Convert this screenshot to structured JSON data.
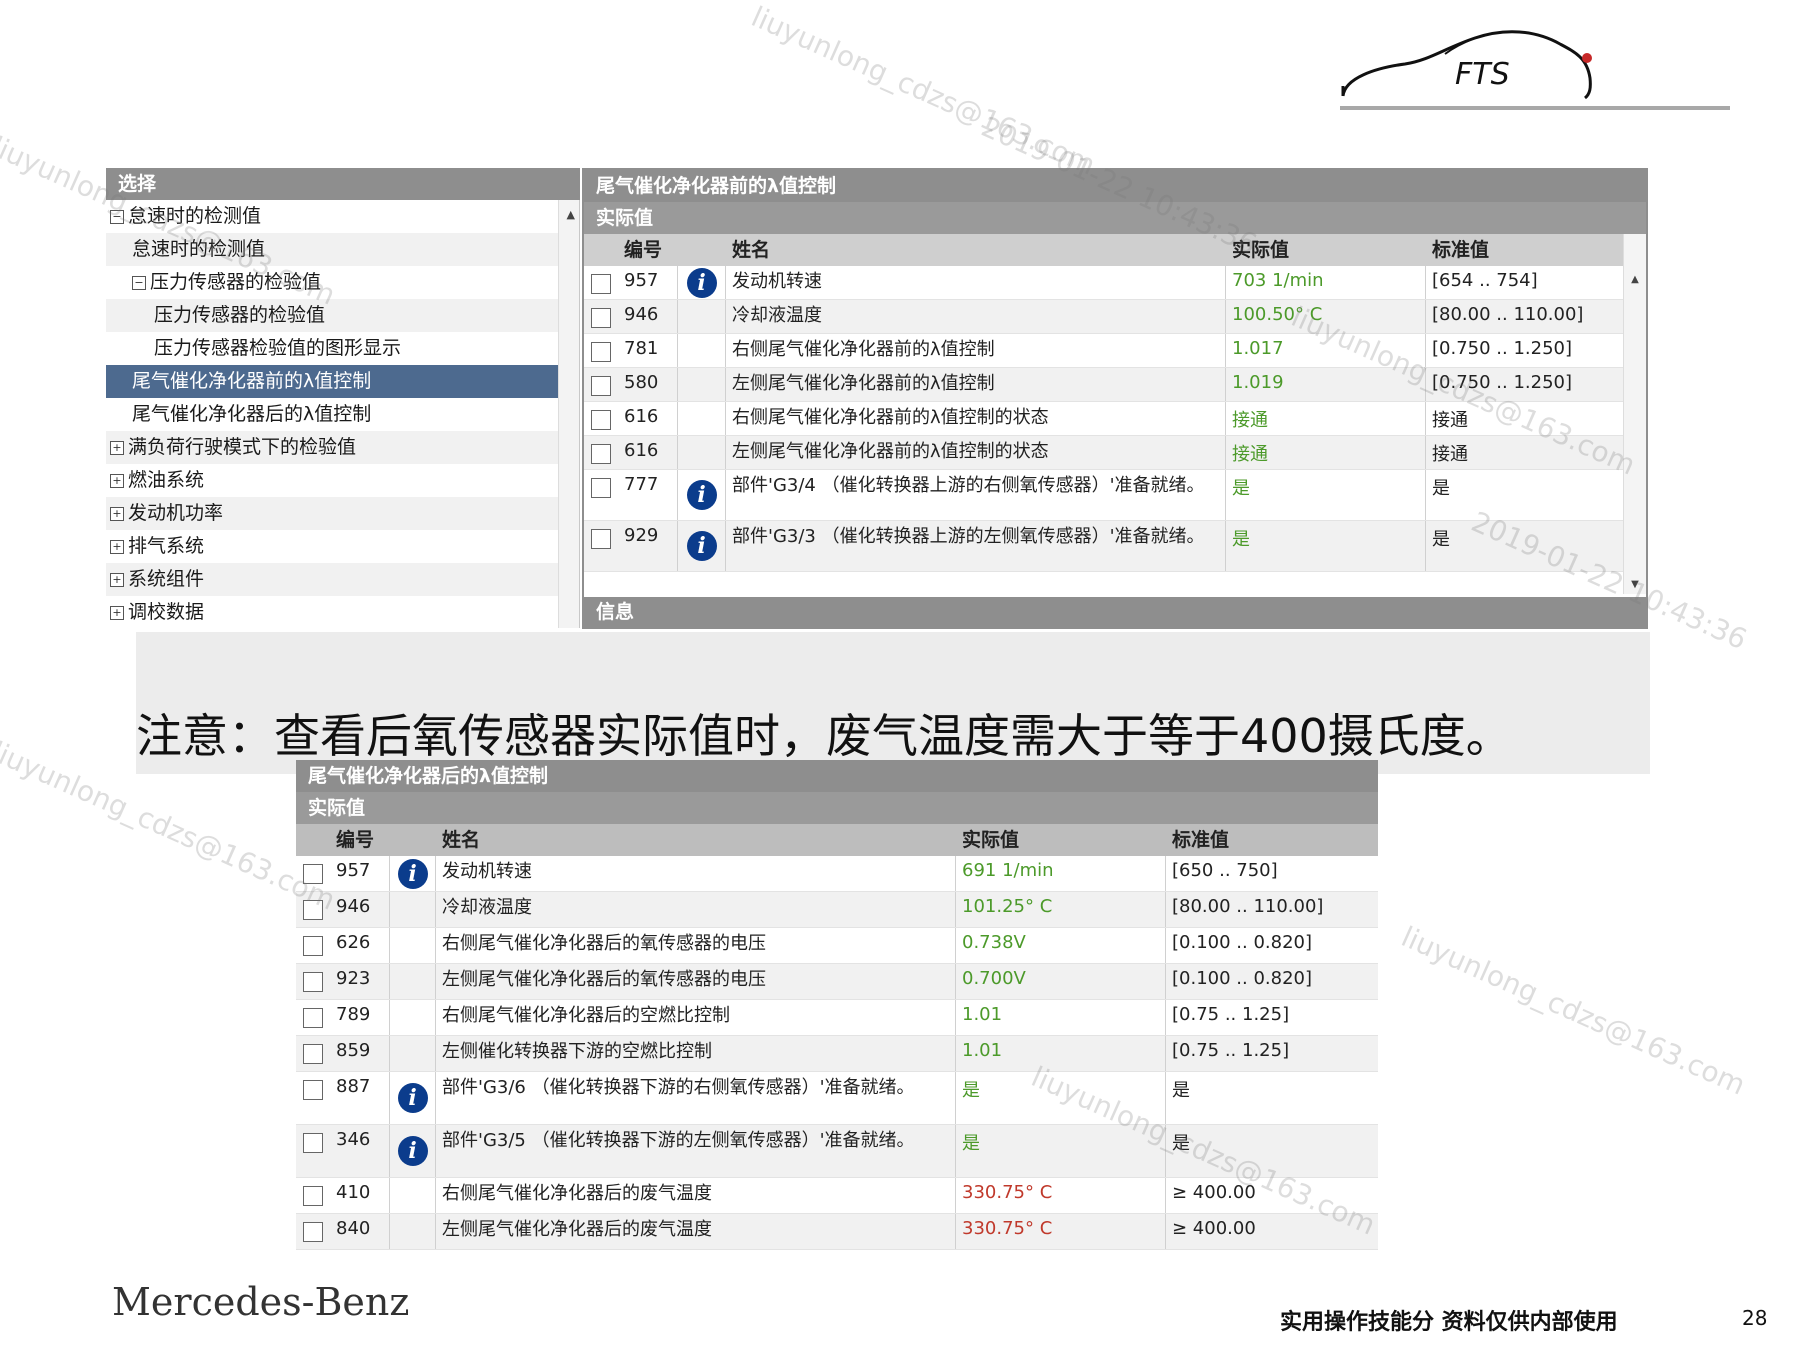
{
  "logo_text": "FTS",
  "tree": {
    "header": "选择",
    "items": [
      {
        "label": "怠速时的检测值",
        "toggle": "-",
        "indent": 0
      },
      {
        "label": "怠速时的检测值",
        "toggle": "",
        "indent": 1
      },
      {
        "label": "压力传感器的检验值",
        "toggle": "-",
        "indent": 1
      },
      {
        "label": "压力传感器的检验值",
        "toggle": "",
        "indent": 2
      },
      {
        "label": "压力传感器检验值的图形显示",
        "toggle": "",
        "indent": 2
      },
      {
        "label": "尾气催化净化器前的λ值控制",
        "toggle": "",
        "indent": 1,
        "selected": true
      },
      {
        "label": "尾气催化净化器后的λ值控制",
        "toggle": "",
        "indent": 1
      },
      {
        "label": "满负荷行驶模式下的检验值",
        "toggle": "+",
        "indent": 0
      },
      {
        "label": "燃油系统",
        "toggle": "+",
        "indent": 0
      },
      {
        "label": "发动机功率",
        "toggle": "+",
        "indent": 0
      },
      {
        "label": "排气系统",
        "toggle": "+",
        "indent": 0
      },
      {
        "label": "系统组件",
        "toggle": "+",
        "indent": 0
      },
      {
        "label": "调校数据",
        "toggle": "+",
        "indent": 0
      }
    ]
  },
  "top_panel": {
    "title": "尾气催化净化器前的λ值控制",
    "subtitle": "实际值",
    "columns": {
      "id": "编号",
      "name": "姓名",
      "value": "实际值",
      "std": "标准值"
    },
    "rows": [
      {
        "id": "957",
        "info": true,
        "name": "发动机转速",
        "value": "703 1/min",
        "std": "[654 .. 754]",
        "color": "green"
      },
      {
        "id": "946",
        "info": false,
        "name": "冷却液温度",
        "value": "100.50° C",
        "std": "[80.00 .. 110.00]",
        "color": "green"
      },
      {
        "id": "781",
        "info": false,
        "name": "右侧尾气催化净化器前的λ值控制",
        "value": "1.017",
        "std": "[0.750 .. 1.250]",
        "color": "green"
      },
      {
        "id": "580",
        "info": false,
        "name": "左侧尾气催化净化器前的λ值控制",
        "value": "1.019",
        "std": "[0.750 .. 1.250]",
        "color": "green"
      },
      {
        "id": "616",
        "info": false,
        "name": "右侧尾气催化净化器前的λ值控制的状态",
        "value": "接通",
        "std": "接通",
        "color": "green"
      },
      {
        "id": "616",
        "info": false,
        "name": "左侧尾气催化净化器前的λ值控制的状态",
        "value": "接通",
        "std": "接通",
        "color": "green"
      },
      {
        "id": "777",
        "info": true,
        "name": "部件'G3/4 （催化转换器上游的右侧氧传感器）'准备就绪。",
        "value": "是",
        "std": "是",
        "color": "green"
      },
      {
        "id": "929",
        "info": true,
        "name": "部件'G3/3 （催化转换器上游的左侧氧传感器）'准备就绪。",
        "value": "是",
        "std": "是",
        "color": "green"
      }
    ],
    "info_bar": "信息"
  },
  "note": "注意：查看后氧传感器实际值时，废气温度需大于等于400摄氏度。",
  "bottom_panel": {
    "title": "尾气催化净化器后的λ值控制",
    "subtitle": "实际值",
    "columns": {
      "id": "编号",
      "name": "姓名",
      "value": "实际值",
      "std": "标准值"
    },
    "rows": [
      {
        "id": "957",
        "info": true,
        "name": "发动机转速",
        "value": "691 1/min",
        "std": "[650 .. 750]",
        "color": "green"
      },
      {
        "id": "946",
        "info": false,
        "name": "冷却液温度",
        "value": "101.25° C",
        "std": "[80.00 .. 110.00]",
        "color": "green"
      },
      {
        "id": "626",
        "info": false,
        "name": "右侧尾气催化净化器后的氧传感器的电压",
        "value": "0.738V",
        "std": "[0.100 .. 0.820]",
        "color": "green"
      },
      {
        "id": "923",
        "info": false,
        "name": "左侧尾气催化净化器后的氧传感器的电压",
        "value": "0.700V",
        "std": "[0.100 .. 0.820]",
        "color": "green"
      },
      {
        "id": "789",
        "info": false,
        "name": "右侧尾气催化净化器后的空燃比控制",
        "value": "1.01",
        "std": "[0.75 .. 1.25]",
        "color": "green"
      },
      {
        "id": "859",
        "info": false,
        "name": "左侧催化转换器下游的空燃比控制",
        "value": "1.01",
        "std": "[0.75 .. 1.25]",
        "color": "green"
      },
      {
        "id": "887",
        "info": true,
        "name": "部件'G3/6 （催化转换器下游的右侧氧传感器）'准备就绪。",
        "value": "是",
        "std": "是",
        "color": "green"
      },
      {
        "id": "346",
        "info": true,
        "name": "部件'G3/5 （催化转换器下游的左侧氧传感器）'准备就绪。",
        "value": "是",
        "std": "是",
        "color": "green"
      },
      {
        "id": "410",
        "info": false,
        "name": "右侧尾气催化净化器后的废气温度",
        "value": "330.75° C",
        "std": "≥ 400.00",
        "color": "red"
      },
      {
        "id": "840",
        "info": false,
        "name": "左侧尾气催化净化器后的废气温度",
        "value": "330.75° C",
        "std": "≥ 400.00",
        "color": "red"
      }
    ]
  },
  "footer": {
    "brand": "Mercedes-Benz",
    "note": "实用操作技能分 资料仅供内部使用",
    "page": "28"
  },
  "watermarks": [
    "liuyunlong_cdzs@163.com",
    "2019-01-22 10:43:36"
  ]
}
